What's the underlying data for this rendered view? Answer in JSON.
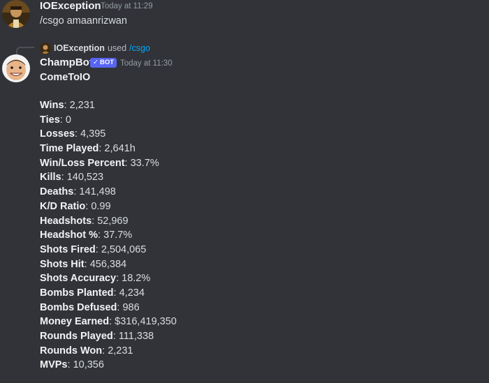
{
  "messages": [
    {
      "author": "IOException",
      "timestamp": "Today at 11:29",
      "text": "/csgo amaanrizwan"
    },
    {
      "reply": {
        "user": "IOException",
        "used_text": "used",
        "command": "/csgo"
      },
      "author": "ChampBot",
      "badge": "BOT",
      "timestamp": "Today at 11:30",
      "heading": "ComeToIO",
      "stats": [
        {
          "label": "Wins",
          "value": "2,231"
        },
        {
          "label": "Ties",
          "value": "0"
        },
        {
          "label": "Losses",
          "value": "4,395"
        },
        {
          "label": "Time Played",
          "value": "2,641h"
        },
        {
          "label": "Win/Loss Percent",
          "value": "33.7%"
        },
        {
          "label": "Kills",
          "value": "140,523"
        },
        {
          "label": "Deaths",
          "value": "141,498"
        },
        {
          "label": "K/D Ratio",
          "value": "0.99"
        },
        {
          "label": "Headshots",
          "value": "52,969"
        },
        {
          "label": "Headshot %",
          "value": "37.7%"
        },
        {
          "label": "Shots Fired",
          "value": "2,504,065"
        },
        {
          "label": "Shots Hit",
          "value": "456,384"
        },
        {
          "label": "Shots Accuracy",
          "value": "18.2%"
        },
        {
          "label": "Bombs Planted",
          "value": "4,234"
        },
        {
          "label": "Bombs Defused",
          "value": "986"
        },
        {
          "label": "Money Earned",
          "value": "$316,419,350"
        },
        {
          "label": "Rounds Played",
          "value": "111,338"
        },
        {
          "label": "Rounds Won",
          "value": "2,231"
        },
        {
          "label": "MVPs",
          "value": "10,356"
        }
      ]
    }
  ],
  "colors": {
    "background": "#313338",
    "bot_badge": "#5865f2",
    "command_link": "#00a8fc",
    "timestamp": "#949ba4"
  },
  "icons": {
    "user_avatar": "user-avatar-photo",
    "bot_avatar": "bot-avatar-face",
    "badge_check": "checkmark-icon"
  }
}
